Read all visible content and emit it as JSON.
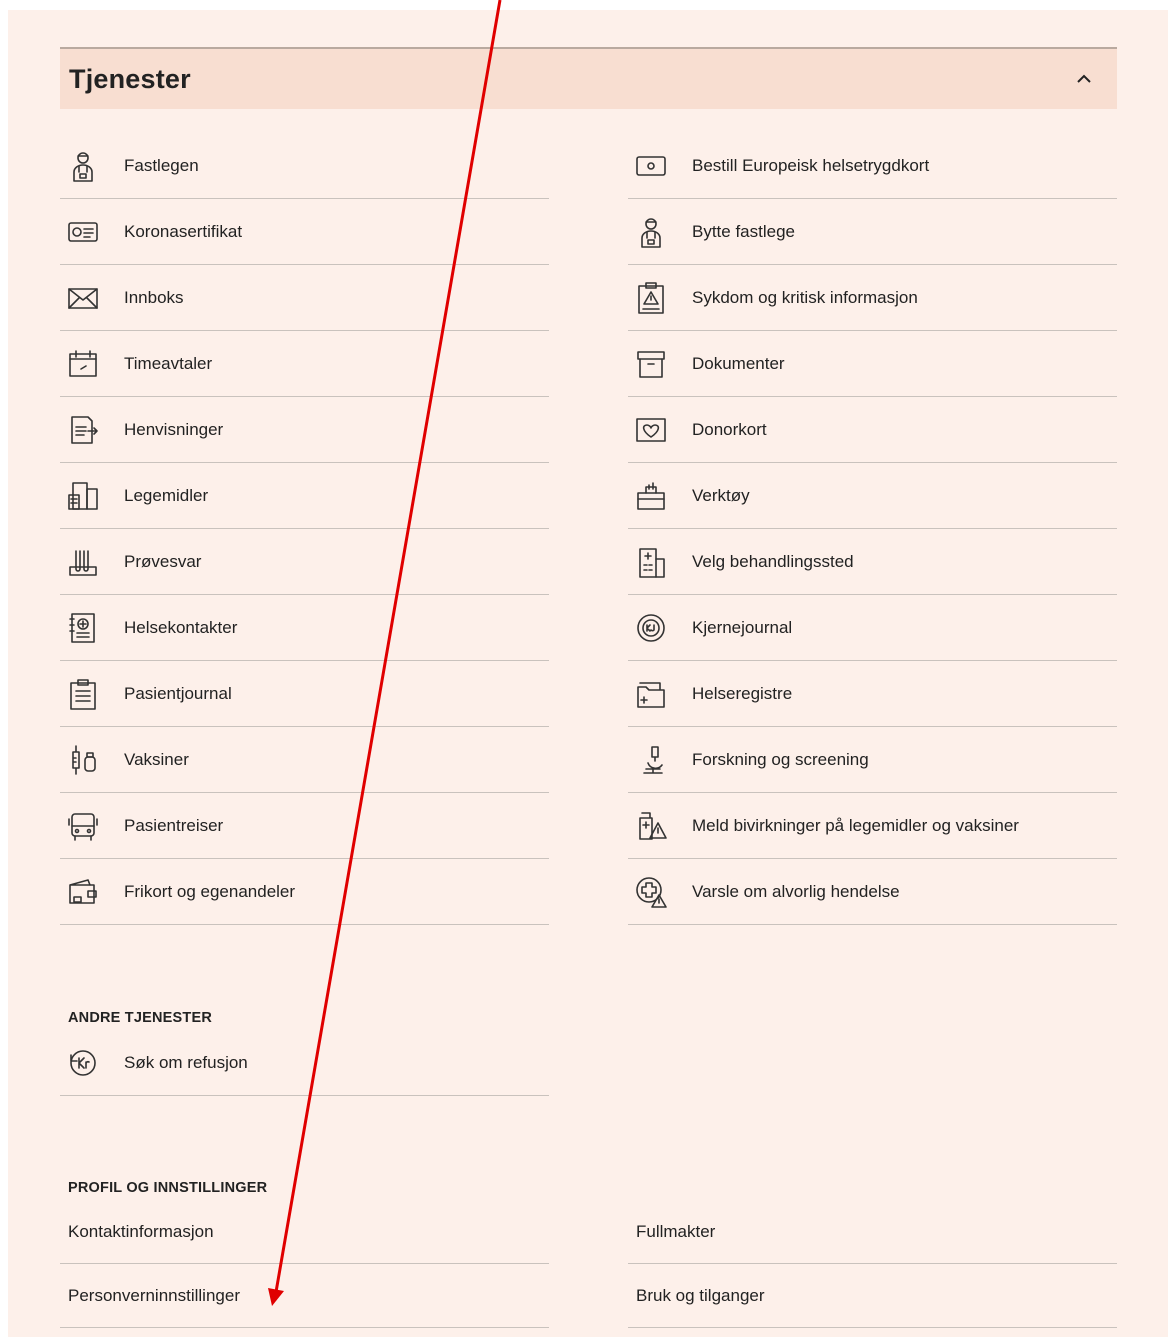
{
  "section": {
    "title": "Tjenester"
  },
  "left_services": [
    {
      "label": "Fastlegen",
      "icon": "doctor-icon"
    },
    {
      "label": "Koronasertifikat",
      "icon": "certificate-icon"
    },
    {
      "label": "Innboks",
      "icon": "envelope-icon"
    },
    {
      "label": "Timeavtaler",
      "icon": "calendar-icon"
    },
    {
      "label": "Henvisninger",
      "icon": "referral-icon"
    },
    {
      "label": "Legemidler",
      "icon": "medicine-icon"
    },
    {
      "label": "Prøvesvar",
      "icon": "test-tubes-icon"
    },
    {
      "label": "Helsekontakter",
      "icon": "contacts-icon"
    },
    {
      "label": "Pasientjournal",
      "icon": "clipboard-icon"
    },
    {
      "label": "Vaksiner",
      "icon": "syringe-icon"
    },
    {
      "label": "Pasientreiser",
      "icon": "bus-icon"
    },
    {
      "label": "Frikort og egenandeler",
      "icon": "wallet-icon"
    }
  ],
  "right_services": [
    {
      "label": "Bestill Europeisk helsetrygdkort",
      "icon": "card-icon"
    },
    {
      "label": "Bytte fastlege",
      "icon": "doctor-icon"
    },
    {
      "label": "Sykdom og kritisk informasjon",
      "icon": "warning-clipboard-icon"
    },
    {
      "label": "Dokumenter",
      "icon": "archive-box-icon"
    },
    {
      "label": "Donorkort",
      "icon": "donor-card-icon"
    },
    {
      "label": "Verktøy",
      "icon": "toolbox-icon"
    },
    {
      "label": "Velg behandlingssted",
      "icon": "hospital-icon"
    },
    {
      "label": "Kjernejournal",
      "icon": "core-journal-icon"
    },
    {
      "label": "Helseregistre",
      "icon": "registry-folder-icon"
    },
    {
      "label": "Forskning og screening",
      "icon": "microscope-icon"
    },
    {
      "label": "Meld bivirkninger på legemidler og vaksiner",
      "icon": "side-effect-icon"
    },
    {
      "label": "Varsle om alvorlig hendelse",
      "icon": "alert-cross-icon"
    }
  ],
  "other_services": {
    "heading": "ANDRE TJENESTER",
    "items": [
      {
        "label": "Søk om refusjon",
        "icon": "refund-icon"
      }
    ]
  },
  "profile": {
    "heading": "PROFIL OG INNSTILLINGER",
    "left": [
      "Kontaktinformasjon",
      "Personverninnstillinger"
    ],
    "right": [
      "Fullmakter",
      "Bruk og tilganger"
    ]
  },
  "colors": {
    "background": "#fdf0ea",
    "header": "#f8ded1",
    "annotation_arrow": "#e00000"
  }
}
